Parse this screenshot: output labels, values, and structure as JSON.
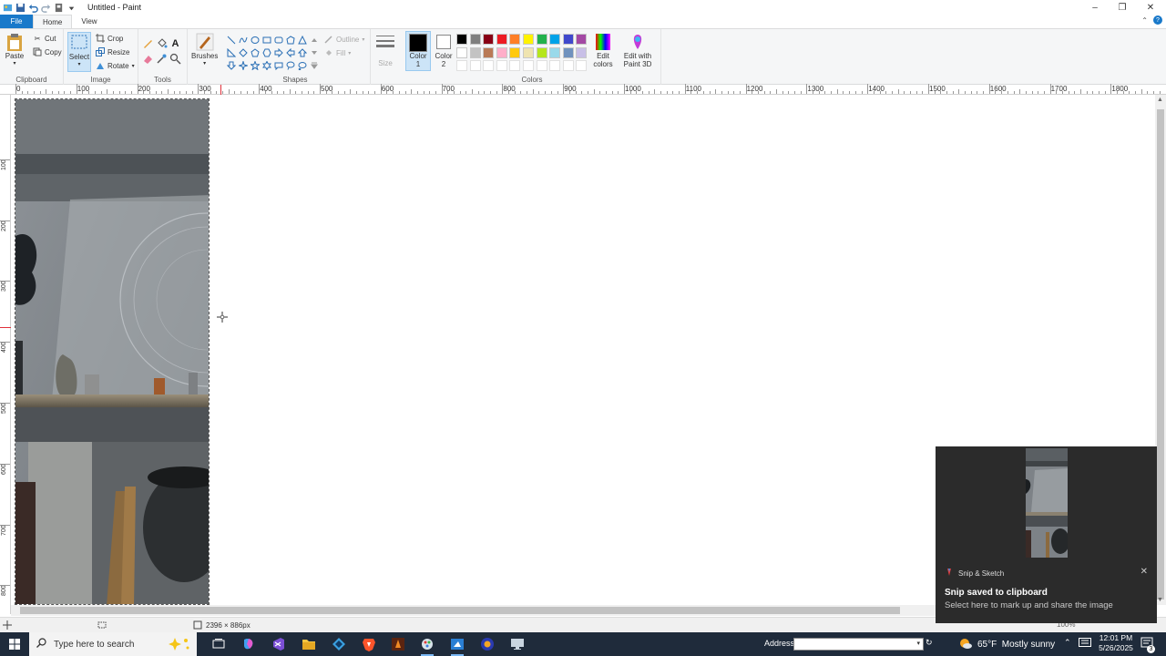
{
  "window": {
    "title": "Untitled - Paint",
    "controls": {
      "minimize": "–",
      "restore": "❐",
      "close": "✕"
    }
  },
  "tabs": {
    "file": "File",
    "home": "Home",
    "view": "View"
  },
  "ribbon": {
    "clipboard": {
      "label": "Clipboard",
      "paste": "Paste",
      "cut": "Cut",
      "copy": "Copy"
    },
    "image": {
      "label": "Image",
      "select": "Select",
      "crop": "Crop",
      "resize": "Resize",
      "rotate": "Rotate"
    },
    "tools": {
      "label": "Tools"
    },
    "brushes": {
      "label": "Brushes"
    },
    "shapes": {
      "label": "Shapes",
      "outline": "Outline",
      "fill": "Fill"
    },
    "size": {
      "label": "Size"
    },
    "colors": {
      "label": "Colors",
      "color1_line1": "Color",
      "color1_line2": "1",
      "color2_line1": "Color",
      "color2_line2": "2",
      "edit_colors_line1": "Edit",
      "edit_colors_line2": "colors",
      "paint3d_line1": "Edit with",
      "paint3d_line2": "Paint 3D",
      "color1_value": "#000000",
      "color2_value": "#ffffff",
      "palette_row1": [
        "#000000",
        "#7f7f7f",
        "#880015",
        "#ed1c24",
        "#ff7f27",
        "#fff200",
        "#22b14c",
        "#00a2e8",
        "#3f48cc",
        "#a349a4"
      ],
      "palette_row2": [
        "#ffffff",
        "#c3c3c3",
        "#b97a57",
        "#ffaec9",
        "#ffc90e",
        "#efe4b0",
        "#b5e61d",
        "#99d9ea",
        "#7092be",
        "#c8bfe7"
      ]
    }
  },
  "ruler": {
    "h_labels": [
      "0",
      "100",
      "200",
      "300",
      "400",
      "500",
      "600",
      "700",
      "800",
      "900",
      "1000",
      "1100",
      "1200",
      "1300",
      "1400",
      "1500",
      "1600",
      "1700",
      "1800"
    ],
    "v_labels": [
      "100",
      "200",
      "300",
      "400",
      "500",
      "600",
      "700",
      "800"
    ]
  },
  "status": {
    "image_size": "2396 × 886px",
    "zoom": "100%"
  },
  "toast": {
    "app": "Snip & Sketch",
    "title": "Snip saved to clipboard",
    "body": "Select here to mark up and share the image"
  },
  "taskbar": {
    "search_placeholder": "Type here to search",
    "address_label": "Address",
    "weather": "65°F  Mostly sunny",
    "time": "12:01 PM",
    "date": "5/26/2025",
    "notif_count": "3"
  }
}
